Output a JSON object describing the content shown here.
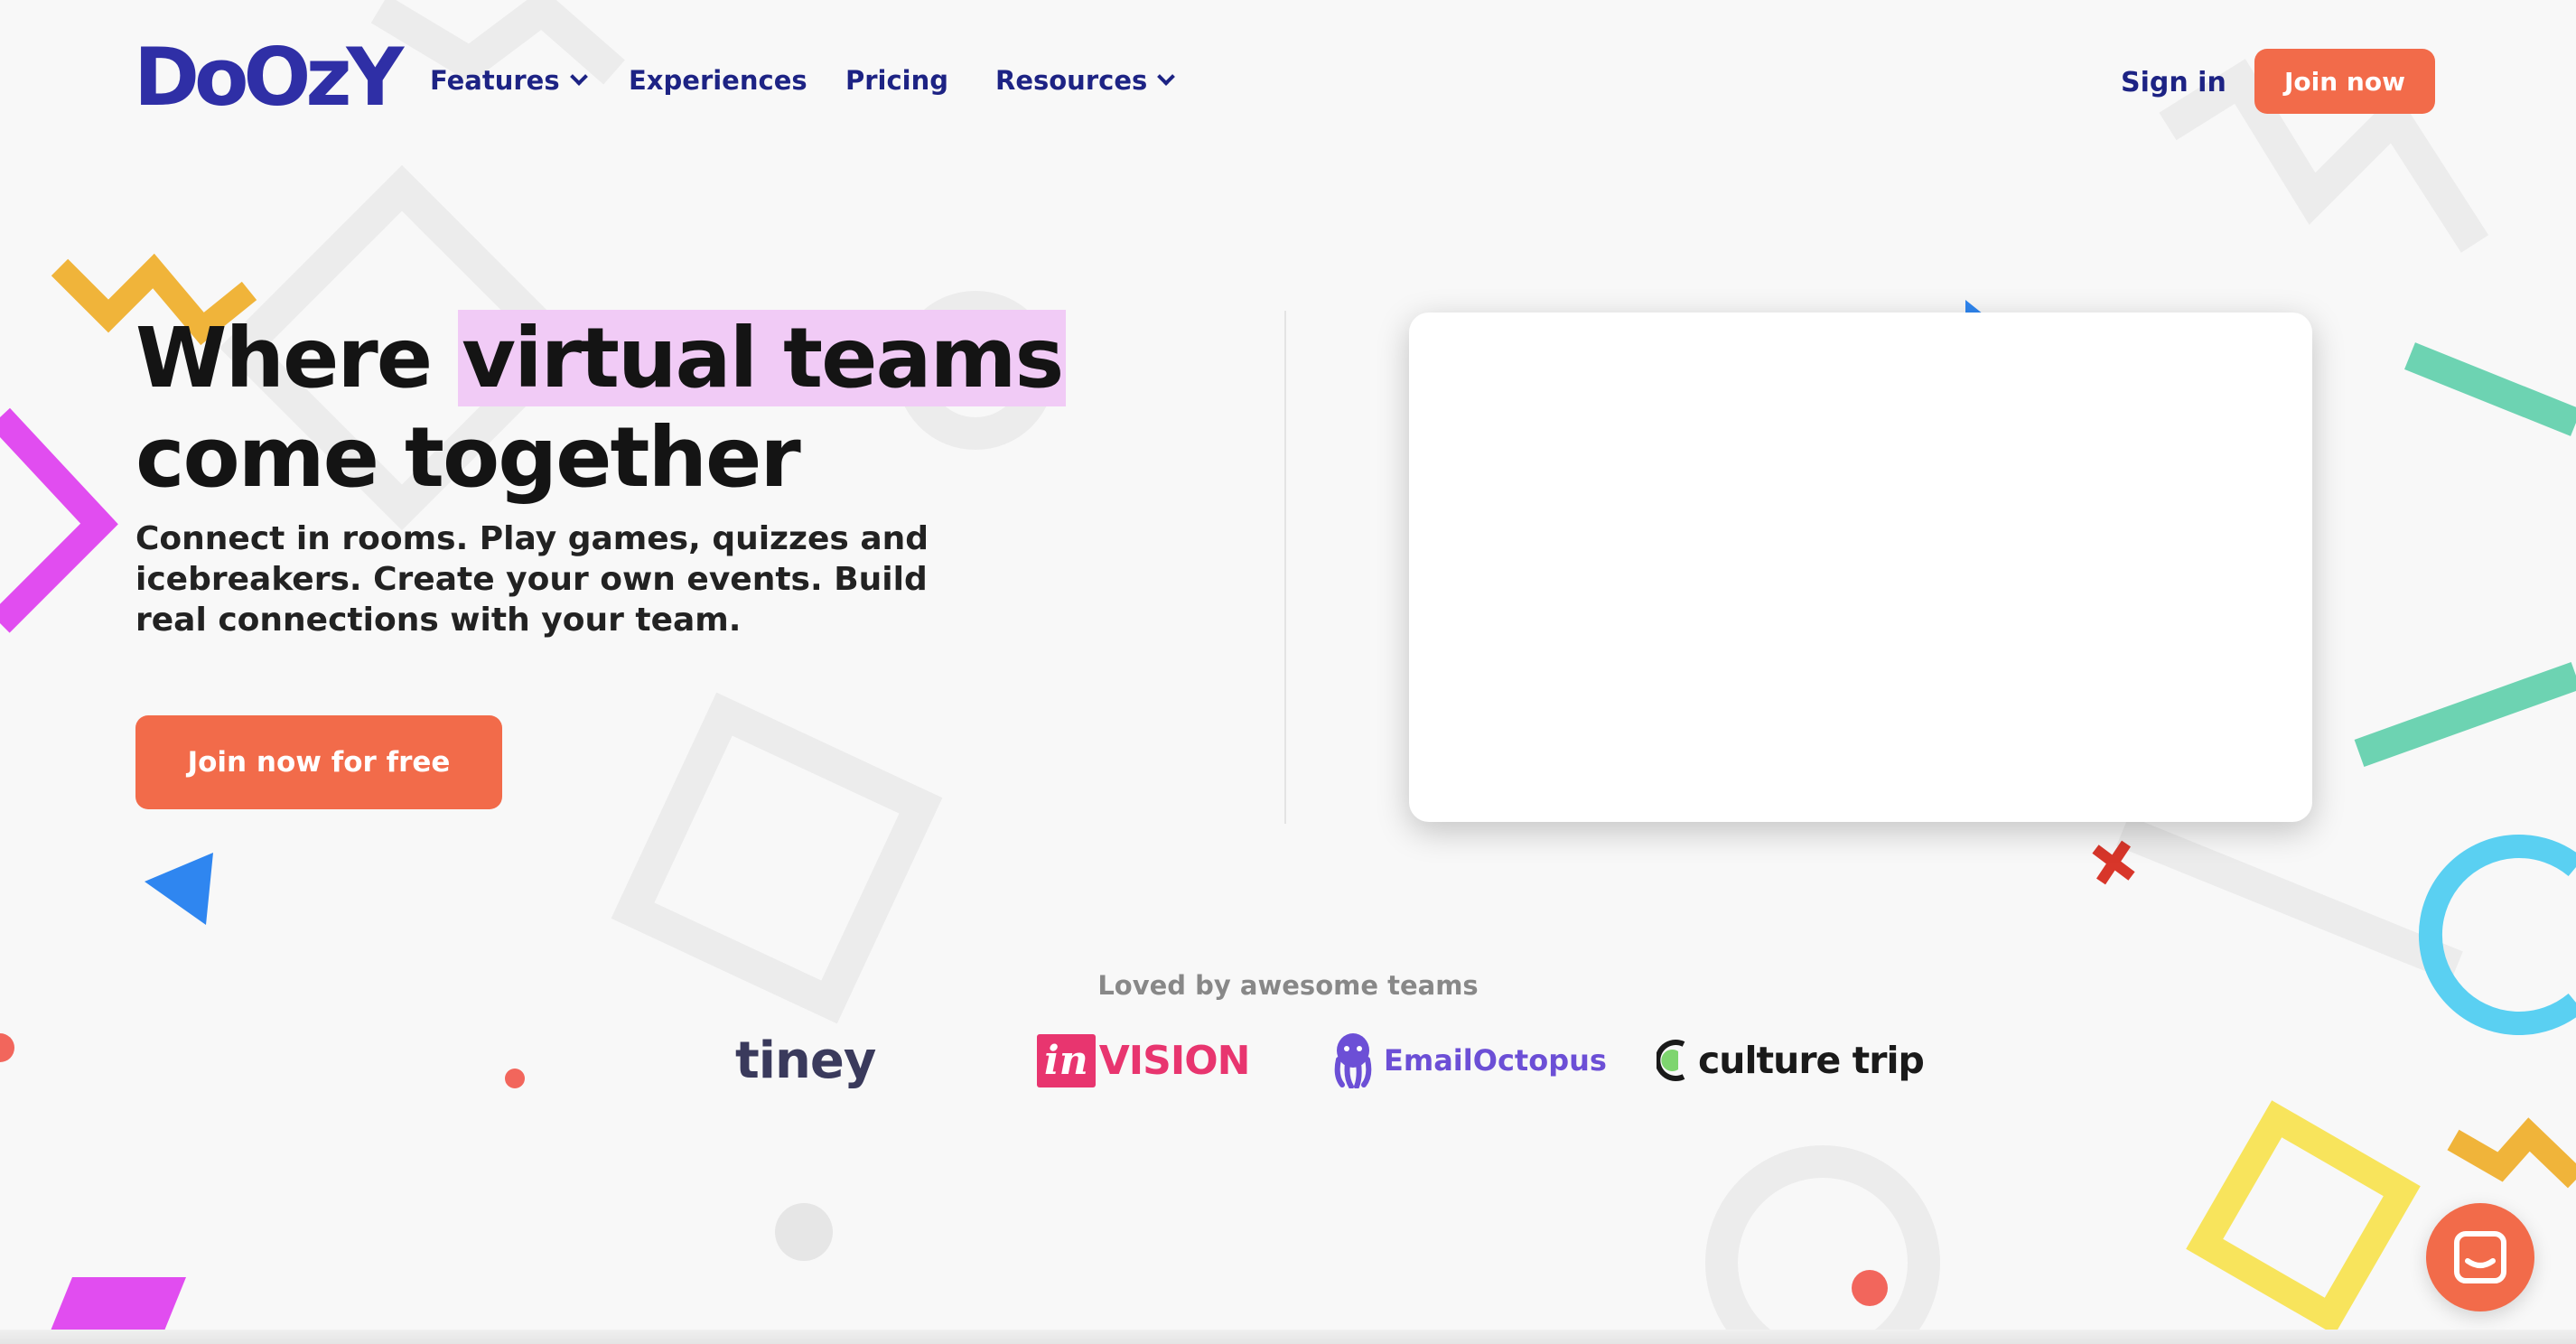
{
  "brand": {
    "logo_text": "DoOzY",
    "accent": "#f26b4a",
    "nav_color": "#1d2384",
    "highlight": "#f1cbf6"
  },
  "nav": {
    "items": [
      {
        "label": "Features",
        "has_dropdown": true
      },
      {
        "label": "Experiences",
        "has_dropdown": false
      },
      {
        "label": "Pricing",
        "has_dropdown": false
      },
      {
        "label": "Resources",
        "has_dropdown": true
      }
    ],
    "sign_in": "Sign in",
    "join_now": "Join now"
  },
  "hero": {
    "title_before": "Where ",
    "title_highlight": "virtual teams",
    "title_after": "come together",
    "subtitle": "Connect in rooms. Play games, quizzes and icebreakers. Create your own events. Build real connections with your team.",
    "cta": "Join now for free"
  },
  "logos": {
    "heading": "Loved by awesome teams",
    "tiney": "tiney",
    "invision_box": "in",
    "invision_text": "VISION",
    "emailoctopus": "EmailOctopus",
    "culture_trip": "culture trip"
  },
  "chat_widget": {
    "icon": "chat-icon"
  }
}
